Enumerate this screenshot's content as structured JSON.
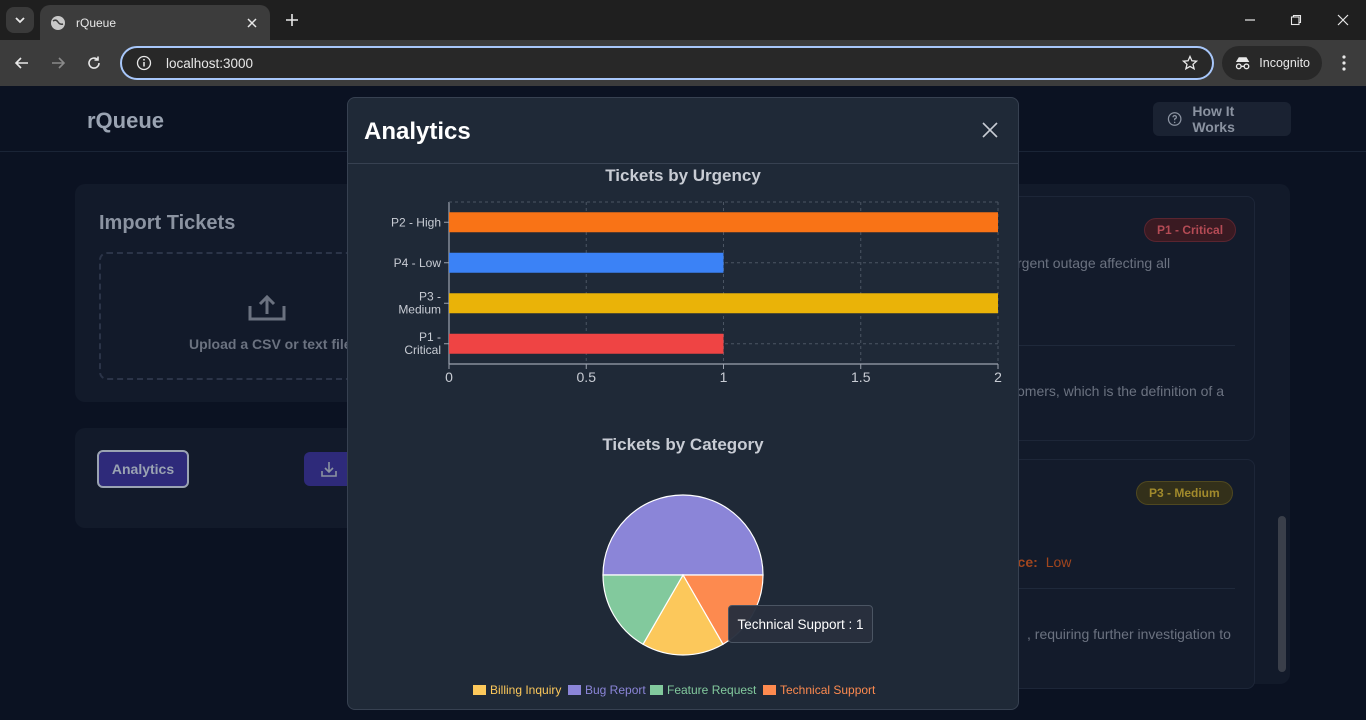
{
  "browser": {
    "tab_title": "rQueue",
    "url": "localhost:3000",
    "incognito_label": "Incognito"
  },
  "app": {
    "brand": "rQueue",
    "how_it_works": "How It Works",
    "import": {
      "title": "Import Tickets",
      "dropzone_text": "Upload a CSV or text file"
    },
    "actions": {
      "analytics_label": "Analytics"
    },
    "tickets": [
      {
        "badge": "P1 - Critical",
        "text": "rgent outage affecting all"
      },
      {
        "text": "omers, which is the definition of a"
      },
      {
        "badge": "P3 - Medium",
        "confidence_label": "nce:",
        "confidence_value": "Low"
      },
      {
        "text": ", requiring further investigation to"
      }
    ]
  },
  "modal": {
    "title": "Analytics"
  },
  "colors": {
    "orange": "#f97316",
    "blue": "#3b82f6",
    "yellow": "#eab308",
    "red": "#ef4444",
    "billing": "#fcc85b",
    "bug": "#8b85d8",
    "feature": "#82c99d",
    "technical": "#fd8a4f"
  },
  "chart_data": [
    {
      "type": "bar",
      "orientation": "horizontal",
      "title": "Tickets by Urgency",
      "categories": [
        "P2 - High",
        "P4 - Low",
        "P3 - Medium",
        "P1 - Critical"
      ],
      "values": [
        2,
        1,
        2,
        1
      ],
      "xlim": [
        0,
        2
      ],
      "xticks": [
        "0",
        "0.5",
        "1",
        "1.5",
        "2"
      ],
      "grid": true
    },
    {
      "type": "pie",
      "title": "Tickets by Category",
      "labels": [
        "Billing Inquiry",
        "Bug Report",
        "Feature Request",
        "Technical Support"
      ],
      "values": [
        1,
        3,
        1,
        1
      ],
      "legend": "bottom",
      "tooltip": "Technical Support : 1"
    }
  ]
}
